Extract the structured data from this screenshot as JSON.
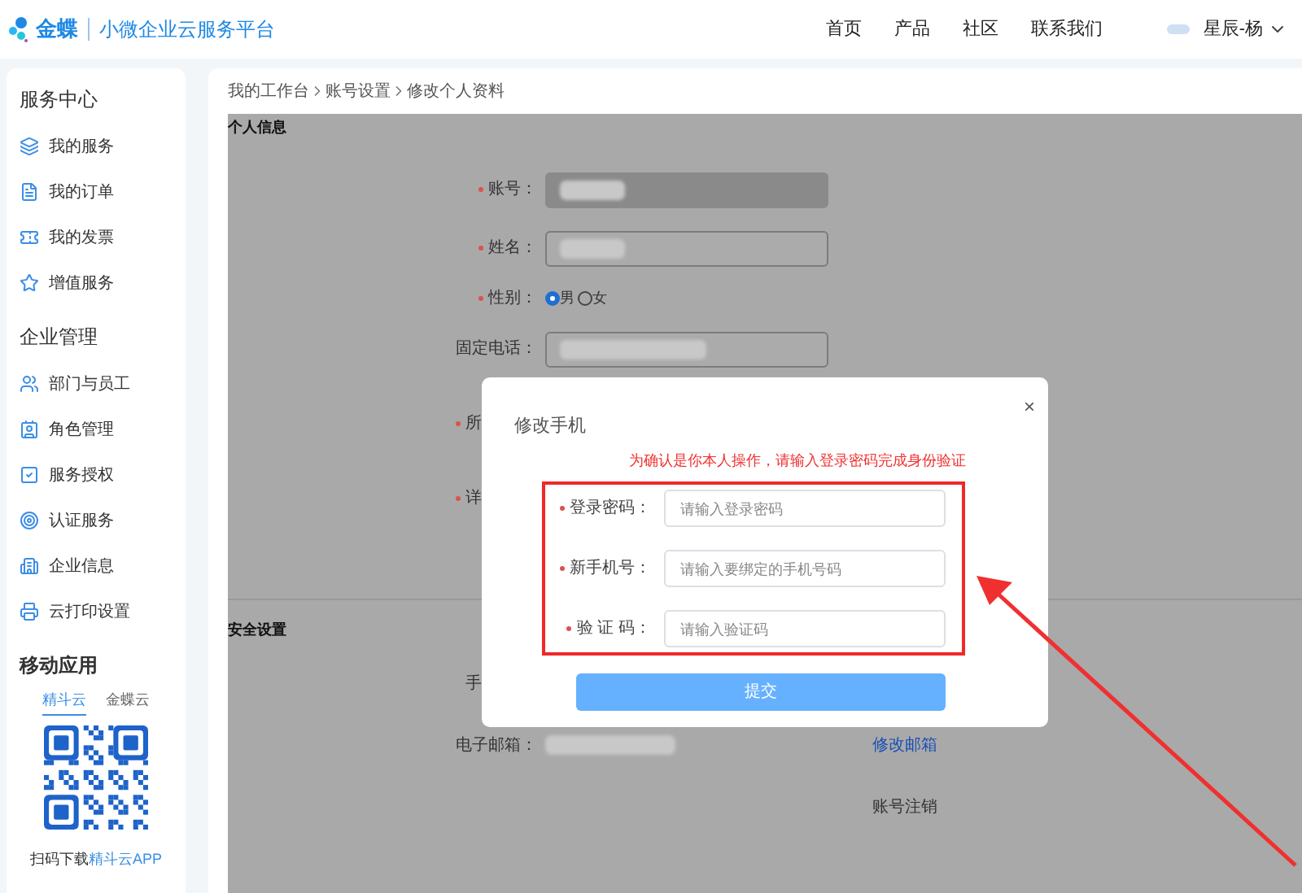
{
  "header": {
    "brand": "金蝶",
    "platform": "小微企业云服务平台",
    "nav": [
      "首页",
      "产品",
      "社区",
      "联系我们"
    ],
    "user": "星辰-杨"
  },
  "sidebar": {
    "sections": [
      {
        "title": "服务中心",
        "items": [
          {
            "label": "我的服务"
          },
          {
            "label": "我的订单"
          },
          {
            "label": "我的发票"
          },
          {
            "label": "增值服务"
          }
        ]
      },
      {
        "title": "企业管理",
        "items": [
          {
            "label": "部门与员工"
          },
          {
            "label": "角色管理"
          },
          {
            "label": "服务授权"
          },
          {
            "label": "认证服务"
          },
          {
            "label": "企业信息"
          },
          {
            "label": "云打印设置"
          }
        ]
      }
    ],
    "mobile": {
      "title": "移动应用",
      "tabs": [
        {
          "label": "精斗云",
          "selected": true
        },
        {
          "label": "金蝶云",
          "selected": false
        }
      ],
      "caption": "扫码下载",
      "caption_link": "精斗云APP"
    }
  },
  "breadcrumb": [
    "我的工作台",
    "账号设置",
    "修改个人资料"
  ],
  "personal": {
    "title": "个人信息",
    "fields": [
      {
        "kind": "input",
        "label": "账号：",
        "required": true,
        "disabled": true
      },
      {
        "kind": "input",
        "label": "姓名：",
        "required": true,
        "disabled": false
      },
      {
        "kind": "radio",
        "label": "性别：",
        "required": true,
        "options": [
          {
            "label": "男",
            "selected": true
          },
          {
            "label": "女",
            "selected": false
          }
        ]
      },
      {
        "kind": "input",
        "label": "固定电话：",
        "required": false,
        "disabled": false
      },
      {
        "kind": "cut",
        "label": "所",
        "required": true
      },
      {
        "kind": "cut",
        "label": "详",
        "required": true
      }
    ]
  },
  "security": {
    "title": "安全设置",
    "rows": [
      {
        "label": "手"
      },
      {
        "label": "电子邮箱：",
        "action": "修改邮箱"
      },
      {
        "action": "账号注销"
      }
    ]
  },
  "dialog": {
    "title": "修改手机",
    "close": "×",
    "notice": "为确认是你本人操作，请输入登录密码完成身份验证",
    "fields": [
      {
        "label": "登录密码：",
        "placeholder": "请输入登录密码"
      },
      {
        "label": "新手机号：",
        "placeholder": "请输入要绑定的手机号码"
      },
      {
        "label": "验 证 码：",
        "placeholder": "请输入验证码"
      }
    ],
    "submit": "提交"
  }
}
